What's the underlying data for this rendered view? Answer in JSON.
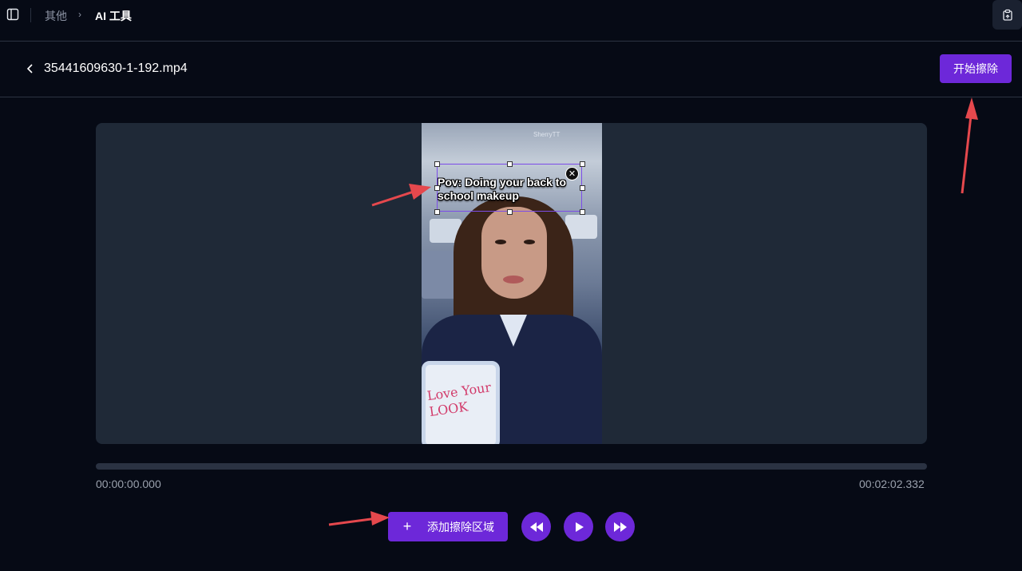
{
  "nav": {
    "breadcrumb_parent": "其他",
    "breadcrumb_separator": "›",
    "breadcrumb_current": "AI 工具"
  },
  "file": {
    "name": "35441609630-1-192.mp4",
    "start_erase_label": "开始擦除"
  },
  "video": {
    "caption": "Pov: Doing your back to\nschool makeup",
    "watermark": "SherryTT",
    "card_text": "Love Your LOOK"
  },
  "timeline": {
    "current_time": "00:00:00.000",
    "total_time": "00:02:02.332",
    "progress": 0
  },
  "controls": {
    "add_region_icon": "+",
    "add_region_label": "添加擦除区域",
    "rewind_icon": "rewind-icon",
    "play_icon": "play-icon",
    "forward_icon": "fast-forward-icon"
  },
  "colors": {
    "accent": "#6d28d9",
    "background": "#060a15",
    "panel": "#1f2937",
    "annotation_arrow": "#e5484d"
  }
}
